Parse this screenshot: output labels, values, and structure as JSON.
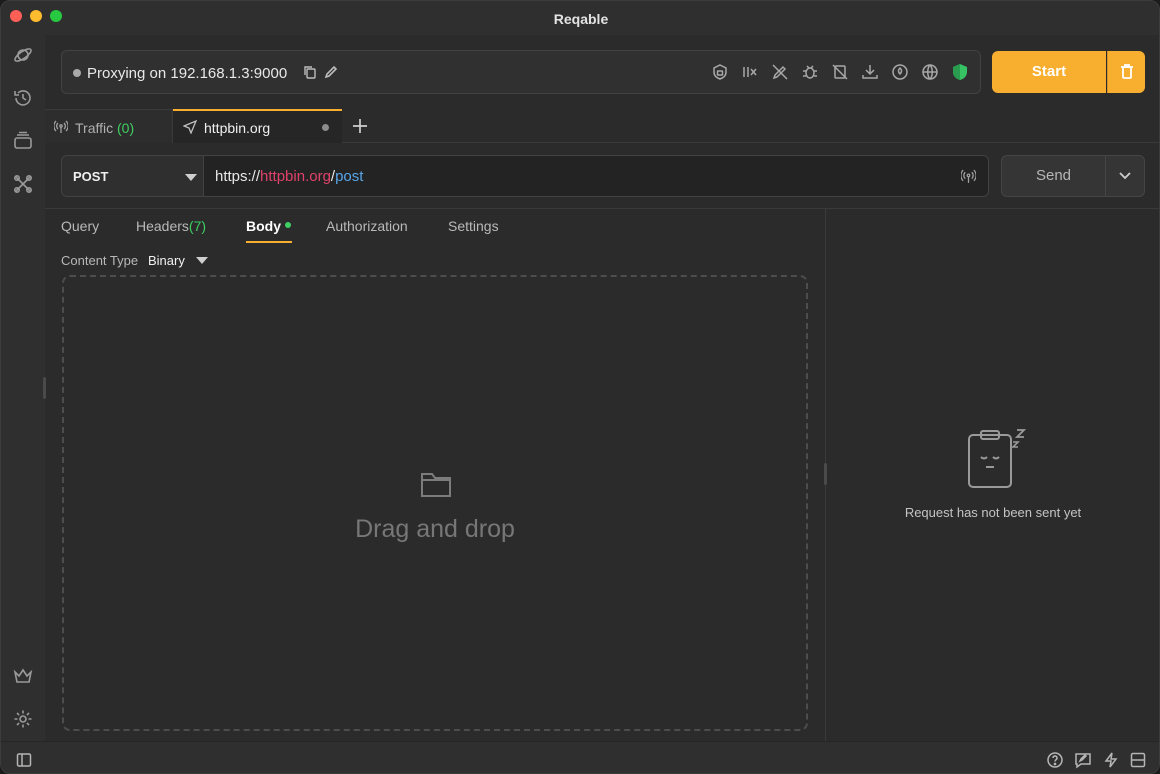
{
  "window": {
    "title": "Reqable",
    "traffic_lights": {
      "close": "#ff5f57",
      "minimize": "#febc2e",
      "zoom": "#28c840"
    }
  },
  "sidebar": {
    "items": [
      {
        "icon": "planet-icon"
      },
      {
        "icon": "history-icon"
      },
      {
        "icon": "collections-icon"
      },
      {
        "icon": "tools-icon"
      },
      {
        "icon": "crown-icon"
      },
      {
        "icon": "settings-icon"
      }
    ]
  },
  "proxy": {
    "status_text": "Proxying on 192.168.1.3:9000",
    "toolbar_icons": [
      "lock-icon",
      "throttle-icon",
      "rewrite-off-icon",
      "debug-icon",
      "breakpoint-off-icon",
      "download-icon",
      "script-icon",
      "proxy-globe-icon",
      "shield-icon"
    ],
    "start_label": "Start",
    "accent": "#f8ae2f"
  },
  "tabs": {
    "traffic_label": "Traffic",
    "traffic_count": "(0)",
    "request_label": "httpbin.org"
  },
  "request": {
    "method": "POST",
    "url_proto": "https://",
    "url_host": "httpbin.org",
    "url_slash": "/",
    "url_path": "post",
    "send_label": "Send"
  },
  "subtabs": {
    "query": "Query",
    "headers": "Headers",
    "headers_count": "(7)",
    "body": "Body",
    "authorization": "Authorization",
    "settings": "Settings"
  },
  "body": {
    "content_type_label": "Content Type",
    "content_type_value": "Binary",
    "dropzone_text": "Drag and drop"
  },
  "response": {
    "empty_text": "Request has not been sent yet"
  },
  "statusbar": {
    "icons": [
      "sidebar-toggle-icon",
      "help-icon",
      "feedback-icon",
      "flash-icon",
      "layout-icon"
    ]
  }
}
